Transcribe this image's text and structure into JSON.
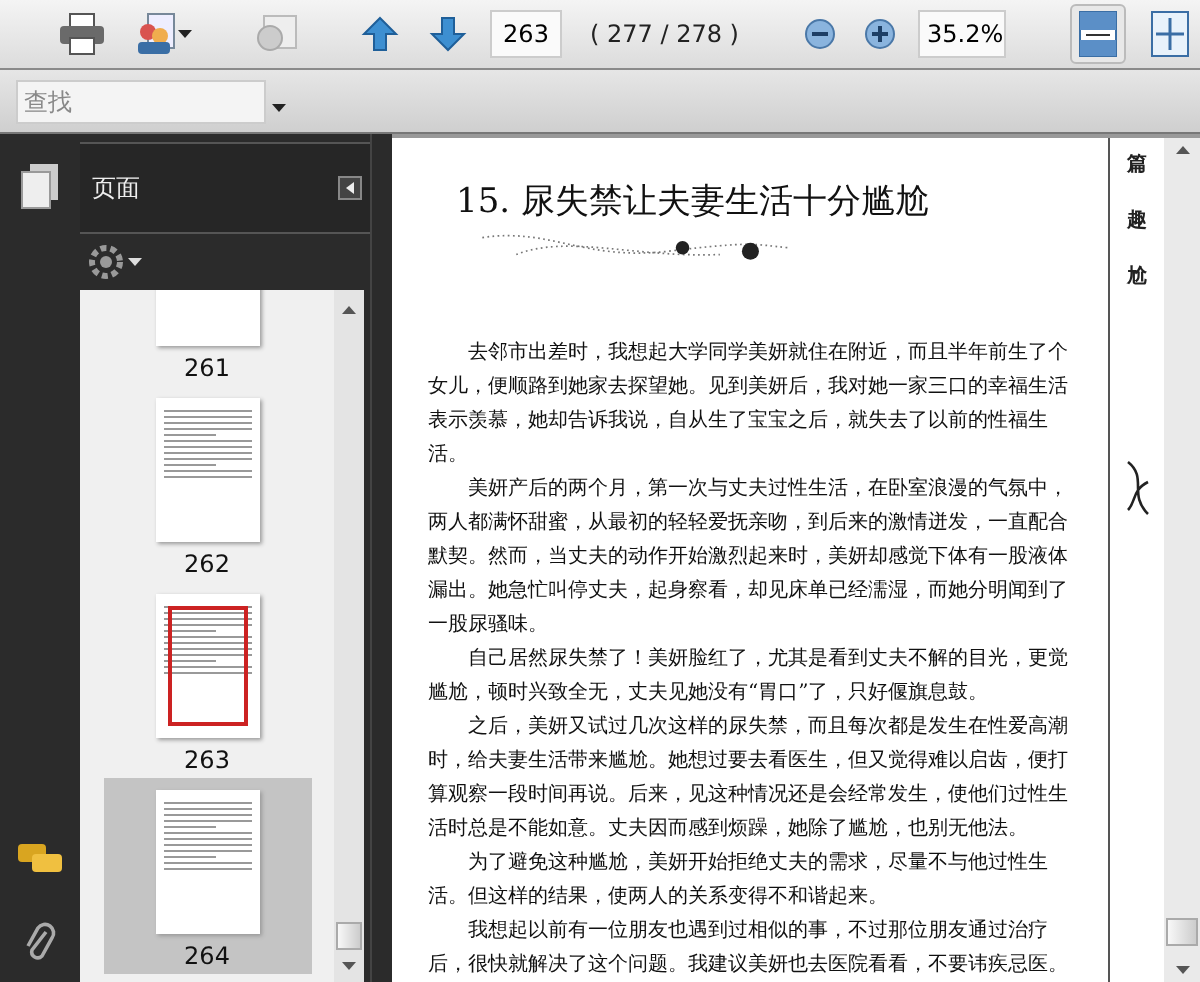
{
  "toolbar": {
    "page_input": "263",
    "page_count": "( 277 / 278 )",
    "zoom": "35.2%",
    "fit_width_active": true
  },
  "find_bar": {
    "placeholder": "查找"
  },
  "side_panel": {
    "title": "页面",
    "thumbnails": [
      {
        "label": "261",
        "selected": false,
        "viewport": false
      },
      {
        "label": "262",
        "selected": false,
        "viewport": false
      },
      {
        "label": "263",
        "selected": false,
        "viewport": true
      },
      {
        "label": "264",
        "selected": true,
        "viewport": false
      }
    ]
  },
  "document": {
    "title": "15. 尿失禁让夫妻生活十分尴尬",
    "side_text": [
      "篇",
      "趣",
      "尬"
    ],
    "paragraphs": [
      "去邻市出差时，我想起大学同学美妍就住在附近，而且半年前生了个女儿，便顺路到她家去探望她。见到美妍后，我对她一家三口的幸福生活表示羡慕，她却告诉我说，自从生了宝宝之后，就失去了以前的性福生活。",
      "美妍产后的两个月，第一次与丈夫过性生活，在卧室浪漫的气氛中，两人都满怀甜蜜，从最初的轻轻爱抚亲吻，到后来的激情迸发，一直配合默契。然而，当丈夫的动作开始激烈起来时，美妍却感觉下体有一股液体漏出。她急忙叫停丈夫，起身察看，却见床单已经濡湿，而她分明闻到了一股尿骚味。",
      "自己居然尿失禁了！美妍脸红了，尤其是看到丈夫不解的目光，更觉尴尬，顿时兴致全无，丈夫见她没有“胃口”了，只好偃旗息鼓。",
      "之后，美妍又试过几次这样的尿失禁，而且每次都是发生在性爱高潮时，给夫妻生活带来尴尬。她想过要去看医生，但又觉得难以启齿，便打算观察一段时间再说。后来，见这种情况还是会经常发生，使他们过性生活时总是不能如意。丈夫因而感到烦躁，她除了尴尬，也别无他法。",
      "为了避免这种尴尬，美妍开始拒绝丈夫的需求，尽量不与他过性生活。但这样的结果，使两人的关系变得不和谐起来。",
      "我想起以前有一位朋友也遇到过相似的事，不过那位朋友通过治疗后，很快就解决了这个问题。我建议美妍也去医院看看，不要讳疾忌医。"
    ]
  }
}
